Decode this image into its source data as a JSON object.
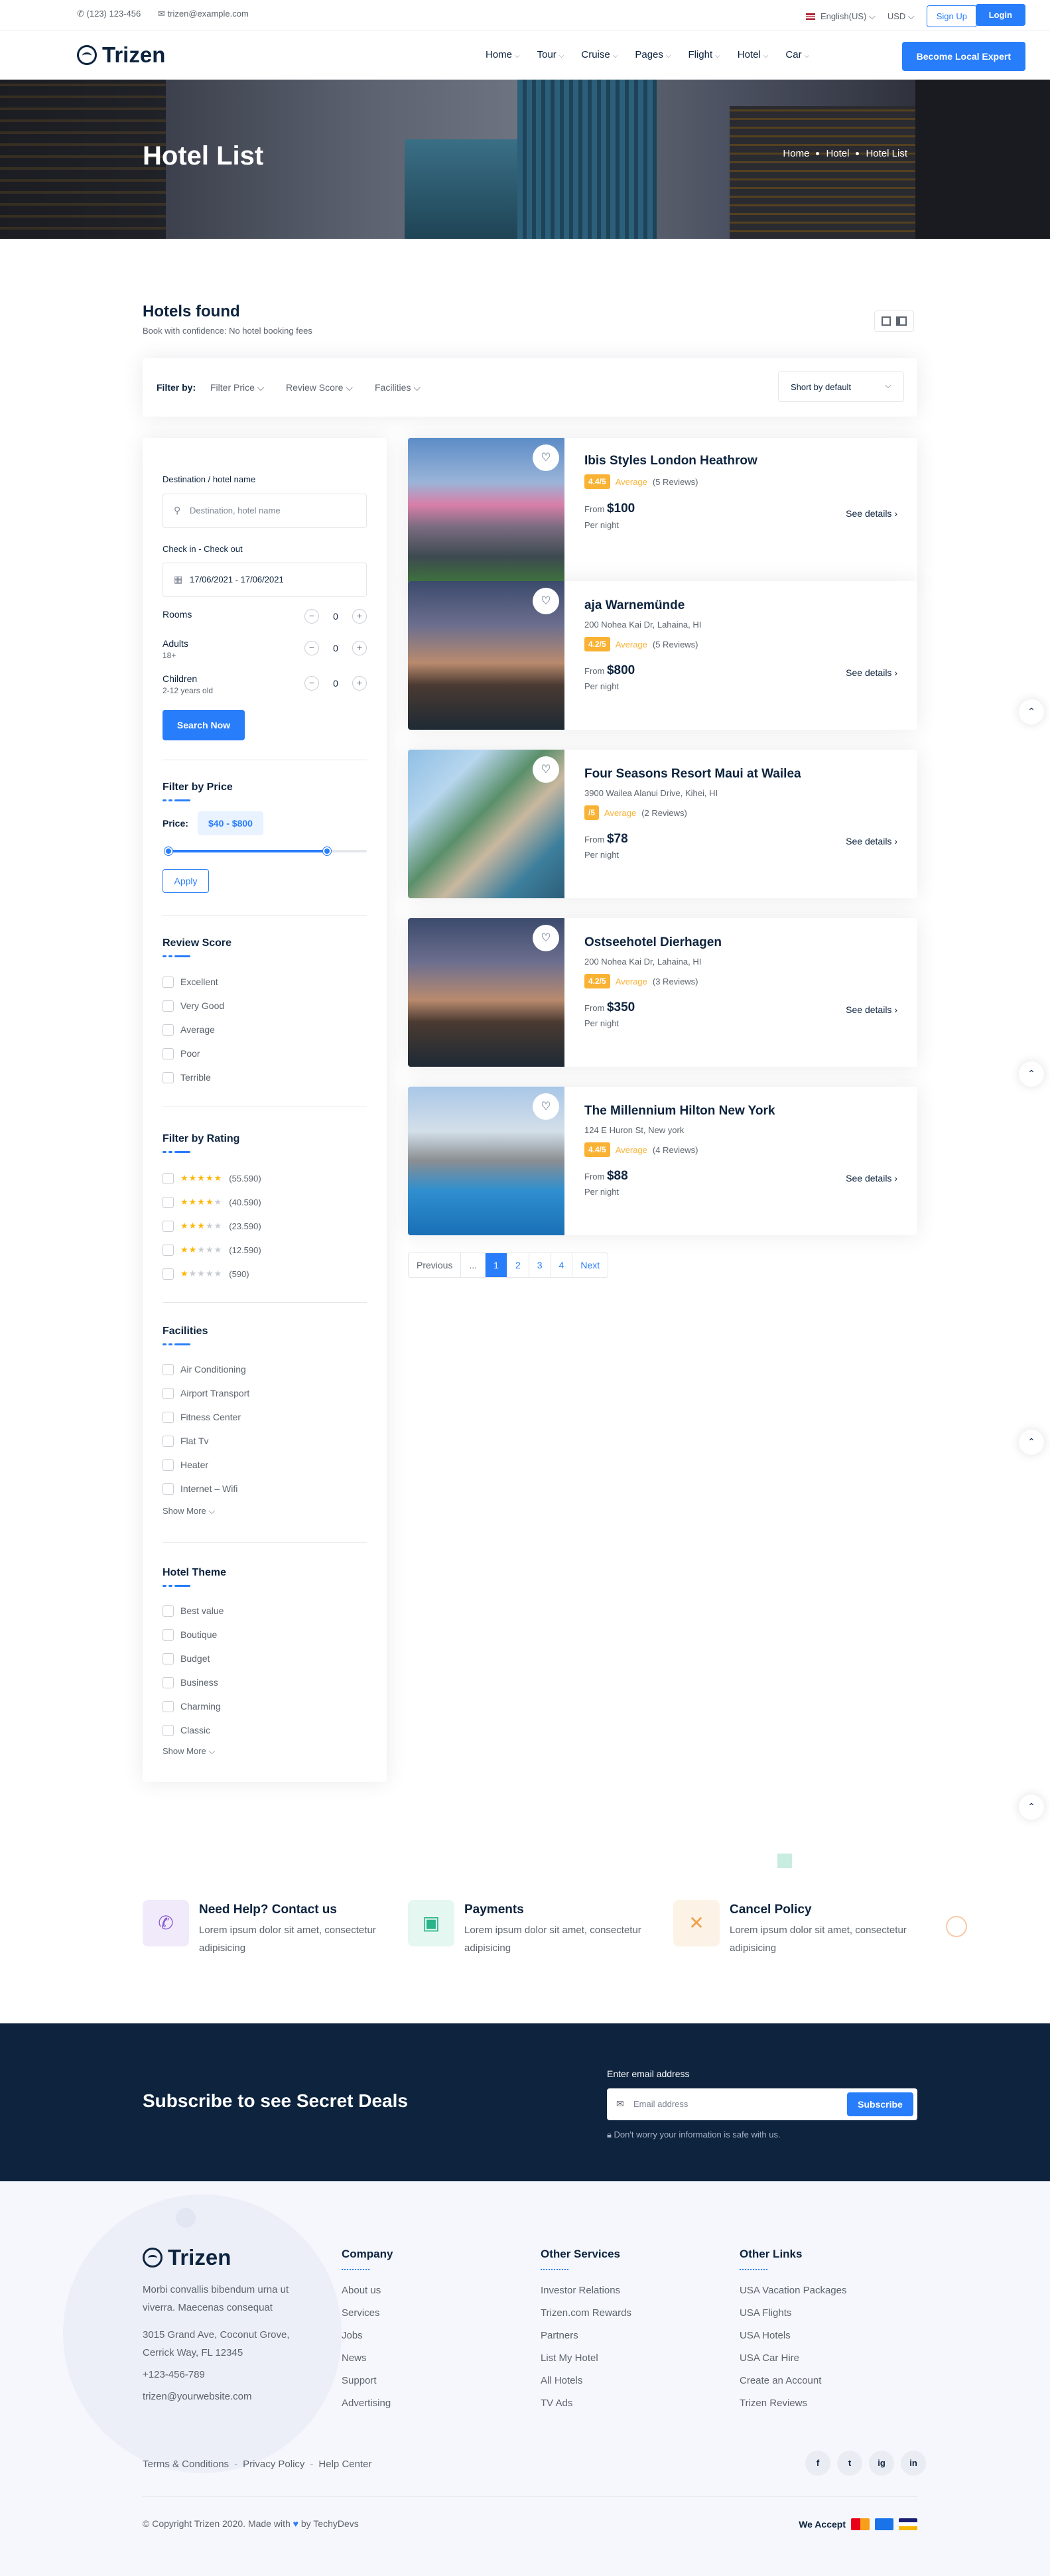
{
  "topbar": {
    "phone": "(123) 123-456",
    "email": "trizen@example.com",
    "language": "English(US)",
    "currency": "USD",
    "signup": "Sign Up",
    "login": "Login"
  },
  "header": {
    "logo": "Trizen",
    "nav": [
      "Home",
      "Tour",
      "Cruise",
      "Pages",
      "Flight",
      "Hotel",
      "Car"
    ],
    "cta": "Become Local Expert"
  },
  "hero": {
    "title": "Hotel List",
    "breadcrumb": [
      "Home",
      "Hotel",
      "Hotel List"
    ]
  },
  "results": {
    "title": "Hotels found",
    "subtitle": "Book with confidence: No hotel booking fees"
  },
  "filterbar": {
    "label": "Filter by:",
    "filters": [
      "Filter Price",
      "Review Score",
      "Facilities"
    ],
    "sort": "Short by default"
  },
  "sidebar": {
    "destination_label": "Destination / hotel name",
    "destination_placeholder": "Destination, hotel name",
    "dates_label": "Check in - Check out",
    "dates_value": "17/06/2021 - 17/06/2021",
    "rooms": {
      "label": "Rooms",
      "value": "0"
    },
    "adults": {
      "label": "Adults",
      "sub": "18+",
      "value": "0"
    },
    "children": {
      "label": "Children",
      "sub": "2-12 years old",
      "value": "0"
    },
    "search_btn": "Search Now",
    "price_heading": "Filter by Price",
    "price_label": "Price:",
    "price_range": "$40 - $800",
    "apply": "Apply",
    "review_heading": "Review Score",
    "review_items": [
      "Excellent",
      "Very Good",
      "Average",
      "Poor",
      "Terrible"
    ],
    "rating_heading": "Filter by Rating",
    "rating_items": [
      {
        "stars": 5,
        "count": "(55.590)"
      },
      {
        "stars": 4,
        "count": "(40.590)"
      },
      {
        "stars": 3,
        "count": "(23.590)"
      },
      {
        "stars": 2,
        "count": "(12.590)"
      },
      {
        "stars": 1,
        "count": "(590)"
      }
    ],
    "facilities_heading": "Facilities",
    "facilities_items": [
      "Air Conditioning",
      "Airport Transport",
      "Fitness Center",
      "Flat Tv",
      "Heater",
      "Internet – Wifi"
    ],
    "theme_heading": "Hotel Theme",
    "theme_items": [
      "Best value",
      "Boutique",
      "Budget",
      "Business",
      "Charming",
      "Classic"
    ],
    "show_more": "Show More"
  },
  "hotels": [
    {
      "name": "Ibis Styles London Heathrow",
      "address": "",
      "rating": "4.4/5",
      "word": "Average",
      "reviews": "(5 Reviews)",
      "from": "From",
      "price": "$100",
      "per": "Per night",
      "details": "See details"
    },
    {
      "name": "aja Warnemünde",
      "address": "200 Nohea Kai Dr, Lahaina, HI",
      "rating": "4.2/5",
      "word": "Average",
      "reviews": "(5 Reviews)",
      "from": "From",
      "price": "$800",
      "per": "Per night",
      "details": "See details"
    },
    {
      "name": "Four Seasons Resort Maui at Wailea",
      "address": "3900 Wailea Alanui Drive, Kihei, HI",
      "rating": "/5",
      "word": "Average",
      "reviews": "(2 Reviews)",
      "from": "From",
      "price": "$78",
      "per": "Per night",
      "details": "See details"
    },
    {
      "name": "Ostseehotel Dierhagen",
      "address": "200 Nohea Kai Dr, Lahaina, HI",
      "rating": "4.2/5",
      "word": "Average",
      "reviews": "(3 Reviews)",
      "from": "From",
      "price": "$350",
      "per": "Per night",
      "details": "See details"
    },
    {
      "name": "The Millennium Hilton New York",
      "address": "124 E Huron St, New york",
      "rating": "4.4/5",
      "word": "Average",
      "reviews": "(4 Reviews)",
      "from": "From",
      "price": "$88",
      "per": "Per night",
      "details": "See details"
    }
  ],
  "pagination": [
    "Previous",
    "...",
    "1",
    "2",
    "3",
    "4",
    "Next"
  ],
  "info": [
    {
      "title": "Need Help? Contact us",
      "text": "Lorem ipsum dolor sit amet, consectetur adipisicing",
      "icon": "phone-icon"
    },
    {
      "title": "Payments",
      "text": "Lorem ipsum dolor sit amet, consectetur adipisicing",
      "icon": "money-icon"
    },
    {
      "title": "Cancel Policy",
      "text": "Lorem ipsum dolor sit amet, consectetur adipisicing",
      "icon": "close-icon"
    }
  ],
  "subscribe": {
    "title": "Subscribe to see Secret Deals",
    "label": "Enter email address",
    "placeholder": "Email address",
    "button": "Subscribe",
    "note": "Don't worry your information is safe with us."
  },
  "footer": {
    "logo": "Trizen",
    "about": "Morbi convallis bibendum urna ut viverra. Maecenas consequat",
    "address": "3015 Grand Ave, Coconut Grove, Cerrick Way, FL 12345",
    "phone": "+123-456-789",
    "email": "trizen@yourwebsite.com",
    "company_heading": "Company",
    "company": [
      "About us",
      "Services",
      "Jobs",
      "News",
      "Support",
      "Advertising"
    ],
    "services_heading": "Other Services",
    "services": [
      "Investor Relations",
      "Trizen.com Rewards",
      "Partners",
      "List My Hotel",
      "All Hotels",
      "TV Ads"
    ],
    "links_heading": "Other Links",
    "links": [
      "USA Vacation Packages",
      "USA Flights",
      "USA Hotels",
      "USA Car Hire",
      "Create an Account",
      "Trizen Reviews"
    ],
    "bottom_links": [
      "Terms & Conditions",
      "Privacy Policy",
      "Help Center"
    ],
    "socials": [
      "f",
      "t",
      "ig",
      "in"
    ],
    "copyright_a": "© Copyright Trizen 2020. Made with",
    "copyright_b": "by TechyDevs",
    "accept": "We Accept"
  },
  "colors": {
    "accent": "#287dfa",
    "navy": "#0d233e",
    "rating": "#f9b233"
  }
}
